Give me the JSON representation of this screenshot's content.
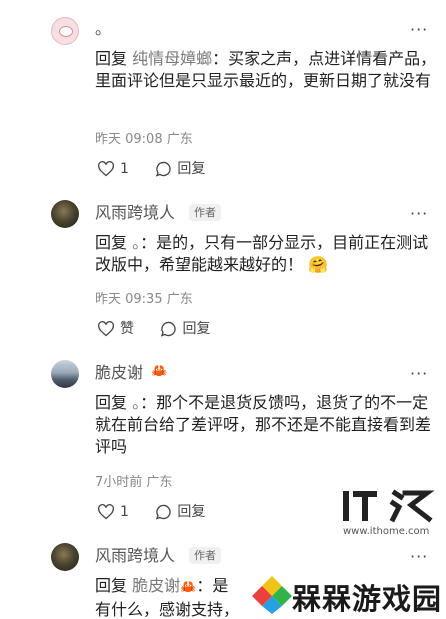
{
  "more_label": "···",
  "comments": [
    {
      "username": "。",
      "reply_prefix": "回复",
      "reply_to": "纯情母嫜螂",
      "text": "：买家之声，点进详情看产品，里面评论但是只显示最近的，更新日期了就没有",
      "time": "昨天 09:08",
      "location": "广东",
      "like_label": "1",
      "reply_label": "回复"
    },
    {
      "username": "风雨跨境人",
      "badge": "作者",
      "reply_prefix": "回复",
      "reply_to": "。",
      "text": "：是的，只有一部分显示，目前正在测试改版中，希望能越来越好的！",
      "emoji": "🤗",
      "time": "昨天 09:35",
      "location": "广东",
      "like_label": "赞",
      "reply_label": "回复"
    },
    {
      "username": "脆皮谢",
      "user_icon": "crab-icon",
      "reply_prefix": "回复",
      "reply_to": "。",
      "text": "：那个不是退货反馈吗，退货了的不一定就在前台给了差评呀，那不还是不能直接看到差评吗",
      "time": "7小时前",
      "location": "广东",
      "like_label": "1",
      "reply_label": "回复"
    },
    {
      "username": "风雨跨境人",
      "badge": "作者",
      "reply_prefix": "回复",
      "reply_to": "脆皮谢",
      "reply_to_icon": "crab-icon",
      "text_line1": "：是",
      "text_line2": "有什么，感谢支持，"
    }
  ],
  "watermark": {
    "logo": "IT之家",
    "site": "www.ithome.com"
  },
  "brand": {
    "name": "槑槑游戏园"
  },
  "colors": {
    "text": "#1f1f1f",
    "muted": "#888888",
    "crab": "#e4552c"
  }
}
